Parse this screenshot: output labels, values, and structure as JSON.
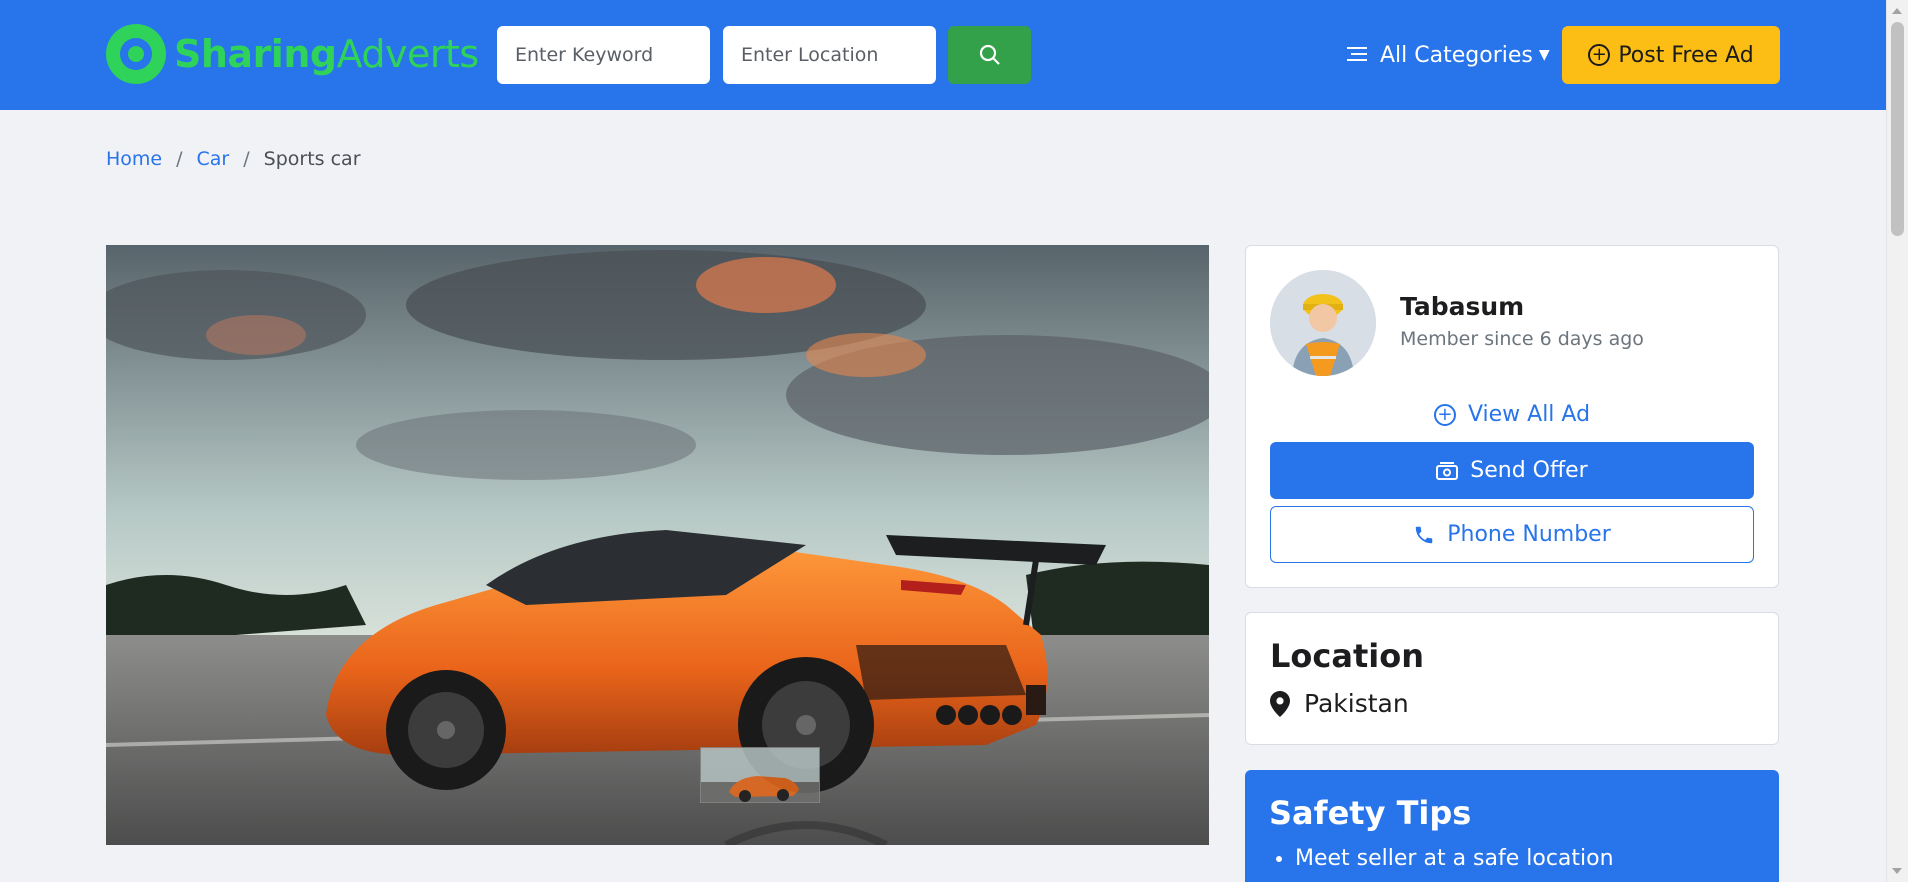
{
  "header": {
    "logo": {
      "text_primary": "Sharing",
      "text_secondary": "Adverts",
      "icon": "logo-swirl-icon",
      "color": "#2fd35a"
    },
    "search": {
      "keyword_placeholder": "Enter Keyword",
      "location_placeholder": "Enter Location",
      "search_icon": "search-icon"
    },
    "categories_label": "All Categories",
    "post_ad_label": "Post Free Ad"
  },
  "breadcrumb": {
    "items": [
      {
        "label": "Home"
      },
      {
        "label": "Car"
      }
    ],
    "current": "Sports car",
    "separator": "/"
  },
  "listing": {
    "image": {
      "subject": "orange sports car",
      "has_thumbnail": true
    }
  },
  "seller": {
    "name": "Tabasum",
    "member_since": "Member since 6 days ago",
    "view_all_label": "View All Ad",
    "send_offer_label": "Send Offer",
    "phone_label": "Phone Number"
  },
  "location": {
    "title": "Location",
    "value": "Pakistan"
  },
  "safety": {
    "title": "Safety Tips",
    "tips": [
      "Meet seller at a safe location"
    ]
  },
  "colors": {
    "primary": "#2874ea",
    "accent_yellow": "#fcbe15",
    "search_green": "#32a149",
    "background": "#f1f2f6"
  }
}
